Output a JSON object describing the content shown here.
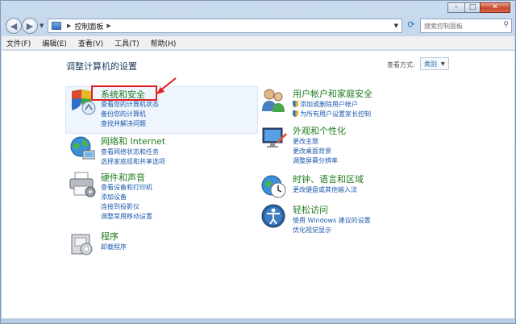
{
  "address": {
    "path": "控制面板",
    "search_placeholder": "搜索控制面板"
  },
  "menu": [
    "文件(F)",
    "编辑(E)",
    "查看(V)",
    "工具(T)",
    "帮助(H)"
  ],
  "content": {
    "title": "调整计算机的设置",
    "view_by_label": "查看方式:",
    "view_by_value": "类别"
  },
  "categories": [
    {
      "title": "系统和安全",
      "icon": "shield-computer-icon",
      "links": [
        "查看您的计算机状态",
        "备份您的计算机",
        "查找并解决问题"
      ]
    },
    {
      "title": "网络和 Internet",
      "icon": "network-globe-icon",
      "links": [
        "查看网络状态和任务",
        "选择家庭组和共享选项"
      ]
    },
    {
      "title": "硬件和声音",
      "icon": "printer-icon",
      "links": [
        "查看设备和打印机",
        "添加设备",
        "连接到投影仪",
        "调整常用移动设置"
      ]
    },
    {
      "title": "程序",
      "icon": "programs-box-icon",
      "links": [
        "卸载程序"
      ]
    },
    {
      "title": "用户帐户和家庭安全",
      "icon": "users-icon",
      "links": [
        "添加或删除用户帐户",
        "为所有用户设置家长控制"
      ]
    },
    {
      "title": "外观和个性化",
      "icon": "monitor-icon",
      "links": [
        "更改主题",
        "更改桌面背景",
        "调整屏幕分辨率"
      ]
    },
    {
      "title": "时钟、语言和区域",
      "icon": "clock-globe-icon",
      "links": [
        "更改键盘或其他输入法"
      ]
    },
    {
      "title": "轻松访问",
      "icon": "accessibility-icon",
      "links": [
        "使用 Windows 建议的设置",
        "优化视觉显示"
      ]
    }
  ],
  "colors": {
    "title_green": "#1e7a1e",
    "link_blue": "#1e5aad",
    "annotation_red": "#e02020"
  }
}
